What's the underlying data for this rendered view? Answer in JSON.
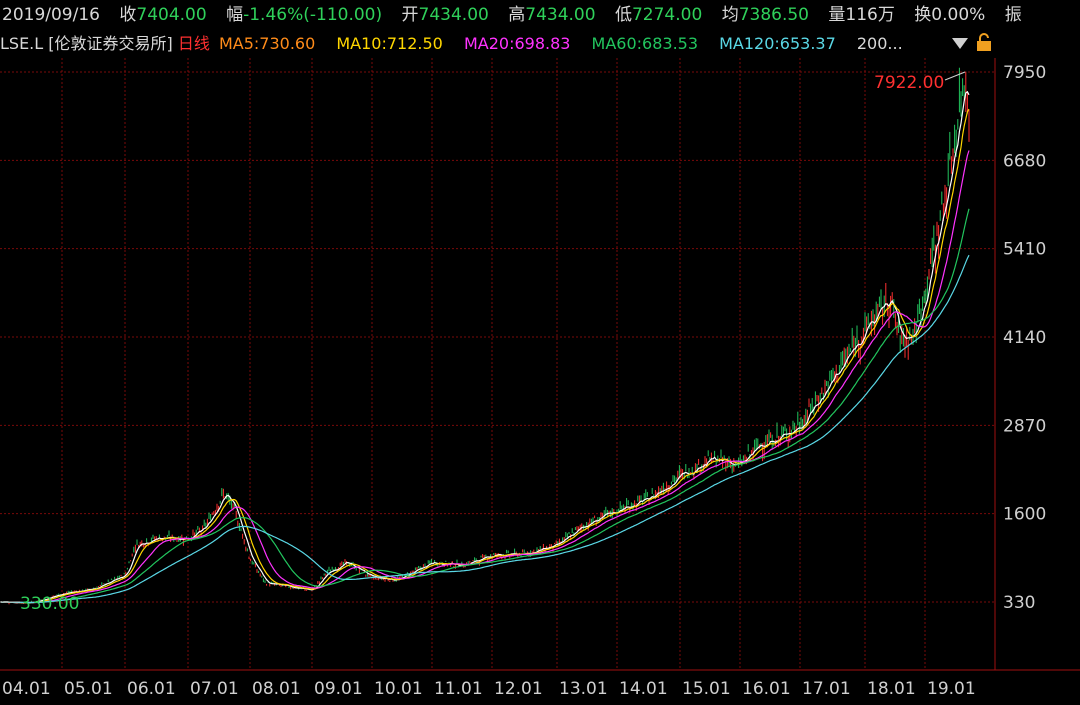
{
  "info": {
    "date": "2019/09/16",
    "close_label": "收",
    "close": "7404.00",
    "change_label": "幅",
    "change": "-1.46%(-110.00)",
    "open_label": "开",
    "open": "7434.00",
    "high_label": "高",
    "high": "7434.00",
    "low_label": "低",
    "low": "7274.00",
    "avg_label": "均",
    "avg": "7386.50",
    "volume_label": "量",
    "volume": "116万",
    "turnover_label": "换",
    "turnover": "0.00%",
    "amplitude_label": "振"
  },
  "legend": {
    "symbol": "LSE.L [伦敦证券交易所]",
    "period": "日线",
    "ma5": "MA5:730.60",
    "ma10": "MA10:712.50",
    "ma20": "MA20:698.83",
    "ma60": "MA60:683.53",
    "ma120": "MA120:653.37",
    "more": "200..."
  },
  "colors": {
    "background": "#000000",
    "grid": "#7a0a0a",
    "up": "#ff3030",
    "down": "#22c55e",
    "ma5": "#ffffff",
    "ma10": "#ffd700",
    "ma20": "#ff33ff",
    "ma60": "#22c55e",
    "ma120": "#5ad8e6",
    "axis_text": "#d0d0d0",
    "period": "#ff3030",
    "value_green": "#2fd05a"
  },
  "chart_data": {
    "type": "candlestick",
    "title": "LSE.L [伦敦证券交易所] 日线",
    "yticks": [
      "7950",
      "6680",
      "5410",
      "4140",
      "2870",
      "1600",
      "330"
    ],
    "ylim": [
      330,
      7950
    ],
    "xticks": [
      "04.01",
      "05.01",
      "06.01",
      "07.01",
      "08.01",
      "09.01",
      "10.01",
      "11.01",
      "12.01",
      "13.01",
      "14.01",
      "15.01",
      "16.01",
      "17.01",
      "18.01",
      "19.01"
    ],
    "max_label": "7922.00",
    "min_label": "330.00",
    "grid": true,
    "price_path": [
      [
        "04.01",
        330
      ],
      [
        "04.07",
        320
      ],
      [
        "05.01",
        450
      ],
      [
        "05.07",
        520
      ],
      [
        "06.01",
        720
      ],
      [
        "06.03",
        1150
      ],
      [
        "06.07",
        1250
      ],
      [
        "07.01",
        1250
      ],
      [
        "07.04",
        1380
      ],
      [
        "07.08",
        1900
      ],
      [
        "07.10",
        1650
      ],
      [
        "08.01",
        950
      ],
      [
        "08.04",
        600
      ],
      [
        "09.01",
        500
      ],
      [
        "09.04",
        760
      ],
      [
        "09.08",
        900
      ],
      [
        "10.01",
        680
      ],
      [
        "10.06",
        650
      ],
      [
        "11.01",
        900
      ],
      [
        "11.07",
        860
      ],
      [
        "12.01",
        1000
      ],
      [
        "12.07",
        1020
      ],
      [
        "13.01",
        1150
      ],
      [
        "13.06",
        1420
      ],
      [
        "14.01",
        1650
      ],
      [
        "14.07",
        1820
      ],
      [
        "15.01",
        2150
      ],
      [
        "15.07",
        2380
      ],
      [
        "16.01",
        2300
      ],
      [
        "16.05",
        2600
      ],
      [
        "16.09",
        2700
      ],
      [
        "17.01",
        2880
      ],
      [
        "17.07",
        3550
      ],
      [
        "18.01",
        4250
      ],
      [
        "18.06",
        4700
      ],
      [
        "18.08",
        4100
      ],
      [
        "18.11",
        4200
      ],
      [
        "19.01",
        4800
      ],
      [
        "19.05",
        6200
      ],
      [
        "19.08",
        7600
      ],
      [
        "19.09",
        7922
      ],
      [
        "19.09.16",
        7404
      ]
    ]
  }
}
